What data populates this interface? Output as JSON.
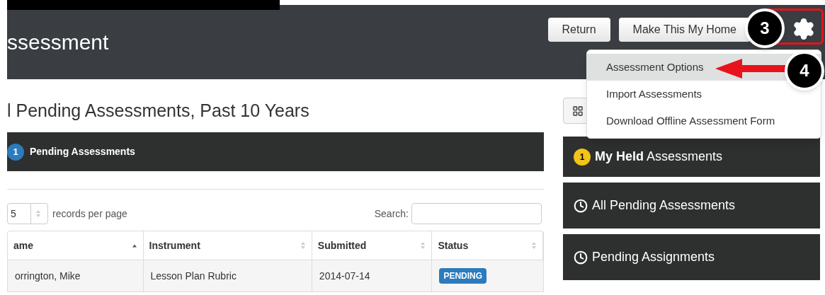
{
  "header": {
    "title": "ssessment",
    "buttons": [
      "Return",
      "Make This My Home"
    ]
  },
  "annotations": [
    {
      "label": "3"
    },
    {
      "label": "4"
    }
  ],
  "menu": {
    "items": [
      {
        "label": "Assessment Options",
        "selected": true
      },
      {
        "label": "Import Assessments",
        "selected": false
      },
      {
        "label": "Download Offline Assessment Form",
        "selected": false
      }
    ]
  },
  "page_title": "l Pending Assessments, Past 10 Years",
  "panel": {
    "badge": "1",
    "title": "Pending Assessments"
  },
  "length": {
    "value": "5",
    "label": "records per page"
  },
  "search": {
    "label": "Search:"
  },
  "table": {
    "columns": [
      {
        "label": "ame",
        "sorted": true
      },
      {
        "label": "Instrument",
        "sorted": false
      },
      {
        "label": "Submitted",
        "sorted": false
      },
      {
        "label": "Status",
        "sorted": false
      }
    ],
    "rows": [
      {
        "cells": [
          "orrington, Mike",
          "Lesson Plan Rubric",
          "2014-07-14"
        ],
        "status": "PENDING"
      }
    ]
  },
  "side_panels": [
    {
      "kind": "count",
      "badge": "1",
      "title": "**My Held** Assessments"
    },
    {
      "kind": "clock",
      "title": "All Pending Assessments"
    },
    {
      "kind": "clock",
      "title": "Pending Assignments"
    }
  ]
}
